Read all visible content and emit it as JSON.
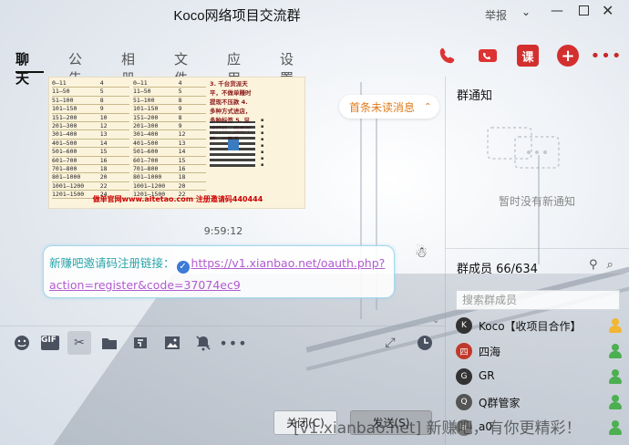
{
  "window": {
    "title": "Koco网络项目交流群",
    "report_label": "举报",
    "dropdown_glyph": "⌄",
    "min_glyph": "—",
    "close_glyph": "✕"
  },
  "tabs": [
    {
      "label": "聊天",
      "active": true
    },
    {
      "label": "公告"
    },
    {
      "label": "相册"
    },
    {
      "label": "文件"
    },
    {
      "label": "应用"
    },
    {
      "label": "设置"
    }
  ],
  "toolbar": {
    "phone_icon": "phone-icon",
    "video_icon": "video-icon",
    "course_label": "课",
    "add_label": "+",
    "more_label": "•••"
  },
  "chat": {
    "image": {
      "rows_left": [
        [
          "0—11",
          "4"
        ],
        [
          "11—50",
          "5"
        ],
        [
          "51—100",
          "8"
        ],
        [
          "101—150",
          "9"
        ],
        [
          "151—200",
          "10"
        ],
        [
          "201—300",
          "12"
        ],
        [
          "301—400",
          "13"
        ],
        [
          "401—500",
          "14"
        ],
        [
          "501—600",
          "15"
        ],
        [
          "601—700",
          "16"
        ],
        [
          "701—800",
          "18"
        ],
        [
          "801—1000",
          "20"
        ],
        [
          "1001—1200",
          "22"
        ],
        [
          "1201—1500",
          "24"
        ]
      ],
      "rows_mid": [
        [
          "0—11",
          "4"
        ],
        [
          "11—50",
          "5"
        ],
        [
          "51—100",
          "8"
        ],
        [
          "101—150",
          "9"
        ],
        [
          "151—200",
          "8"
        ],
        [
          "201—300",
          "9"
        ],
        [
          "301—400",
          "12"
        ],
        [
          "401—500",
          "13"
        ],
        [
          "501—600",
          "14"
        ],
        [
          "601—700",
          "15"
        ],
        [
          "701—800",
          "16"
        ],
        [
          "801—1000",
          "18"
        ],
        [
          "1001—1200",
          "20"
        ],
        [
          "1201—1500",
          "22"
        ]
      ],
      "rules_text": "3. 千台货派天平，不做单赚时提现不压款 4. 多种方式进店，多种标签 5. 足述打标，指定年龄，一搬多",
      "footer": "做单官网www.aitetao.com 注册邀请码440444"
    },
    "unread_label": "首条未读消息",
    "timestamp": "9:59:12",
    "message": {
      "prefix": "新赚吧邀请码注册链接：",
      "link_line1": "https://v1.xianbao.net/oauth.php?",
      "link_line2": "action=register&code=37074ec9"
    }
  },
  "input_tools": [
    "emoji-icon",
    "gif-icon",
    "scissors-icon",
    "folder-icon",
    "dice-icon",
    "image-icon",
    "mute-icon",
    "more-icon",
    "expand-icon",
    "history-icon"
  ],
  "buttons": {
    "close": "关闭(C)",
    "send": "发送(S)"
  },
  "watermark": "[v1.xianbao.net] 新赚吧，有你更精彩！",
  "right_panel": {
    "notice_title": "群通知",
    "notice_empty": "暂时没有新通知",
    "members_title": "群成员 66/634",
    "search_placeholder": "搜索群成员",
    "members": [
      {
        "name": "Koco【收项目合作】",
        "avatar": "K",
        "role": "owner"
      },
      {
        "name": "四海",
        "avatar": "四",
        "role": "admin"
      },
      {
        "name": "GR",
        "avatar": "G",
        "role": "admin"
      },
      {
        "name": "Q群管家",
        "avatar": "Q",
        "role": "admin"
      },
      {
        "name": "a0",
        "avatar": "a",
        "role": "admin"
      }
    ]
  }
}
